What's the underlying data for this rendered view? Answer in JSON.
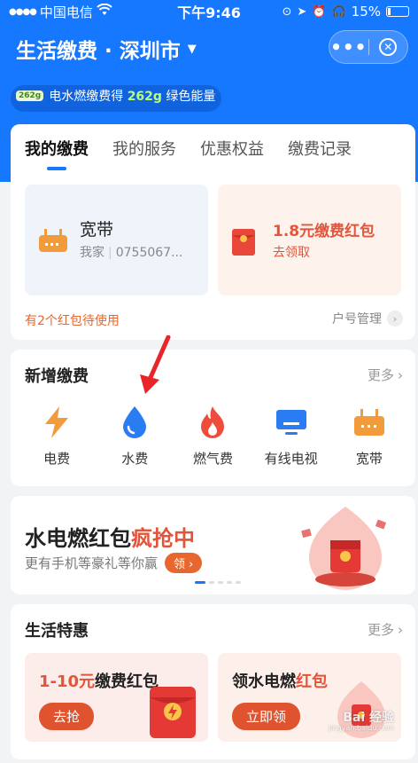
{
  "status_bar": {
    "carrier": "中国电信",
    "time": "下午9:46",
    "battery": "15%",
    "battery_level": 0.15
  },
  "header": {
    "title": "生活缴费 · 深圳市",
    "more_label": "•••"
  },
  "ticker": {
    "badge": "262g",
    "text_prefix": "电水燃缴费得 ",
    "highlight": "262g",
    "text_suffix": " 绿色能量"
  },
  "main_card": {
    "tabs": [
      "我的缴费",
      "我的服务",
      "优惠权益",
      "缴费记录"
    ],
    "broadband": {
      "title": "宽带",
      "owner": "我家",
      "number": "0755067..."
    },
    "red_packet": {
      "title": "1.8元缴费红包",
      "action": "去领取"
    },
    "pending_text": "有2个红包待使用",
    "account_mgmt": "户号管理"
  },
  "new_payment": {
    "title": "新增缴费",
    "more": "更多",
    "items": [
      {
        "label": "电费",
        "icon": "lightning-icon"
      },
      {
        "label": "水费",
        "icon": "water-drop-icon"
      },
      {
        "label": "燃气费",
        "icon": "flame-icon"
      },
      {
        "label": "有线电视",
        "icon": "tv-icon"
      },
      {
        "label": "宽带",
        "icon": "router-icon"
      }
    ]
  },
  "banner": {
    "title_plain": "水电燃红包",
    "title_hot": "疯抢中",
    "subtitle": "更有手机等豪礼等你赢",
    "button": "领"
  },
  "life_deals": {
    "title": "生活特惠",
    "more": "更多",
    "card1": {
      "title_red": "1-10元",
      "title_rest": "缴费红包",
      "button": "去抢"
    },
    "card2": {
      "title_plain": "领水电燃",
      "title_red": "红包",
      "button": "立即领"
    }
  },
  "watermark": {
    "main": "Bai 经验",
    "sub": "jingyan.baidu.com"
  },
  "colors": {
    "brand_blue": "#1677ff",
    "accent_orange": "#e8672f",
    "accent_red": "#e2553a"
  }
}
